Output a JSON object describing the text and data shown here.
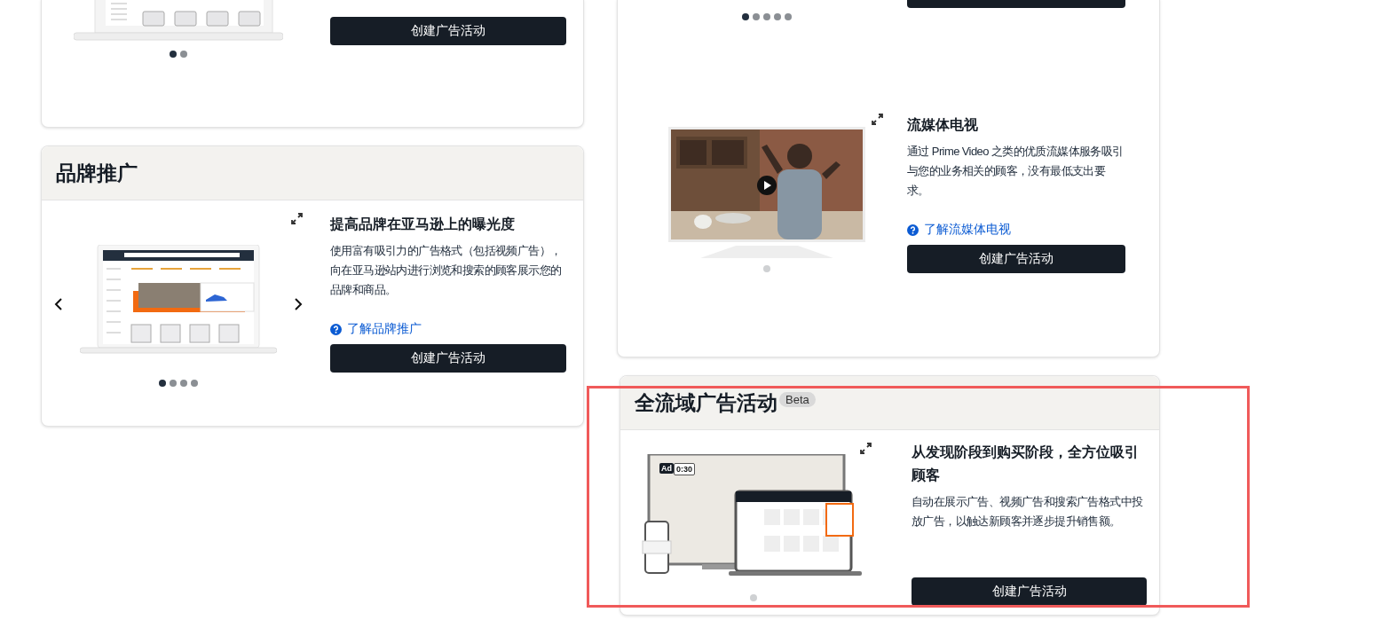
{
  "left_column": [
    {
      "kind": "cut",
      "sections": [
        {
          "kind": "laptop_cut",
          "button": "创建广告活动",
          "slides": [
            {
              "selected": true
            },
            {
              "selected": false
            }
          ]
        }
      ]
    },
    {
      "kind": "full",
      "title": "品牌推广",
      "sections": [
        {
          "kind": "laptop",
          "carousel": true,
          "heading": "提高品牌在亚马逊上的曝光度",
          "description": "使用富有吸引力的广告格式（包括视频广告），向在亚马逊站内进行浏览和搜索的顾客展示您的品牌和商品。",
          "link": "了解品牌推广",
          "button": "创建广告活动",
          "slides": [
            {
              "selected": true
            },
            {
              "selected": false
            },
            {
              "selected": false
            },
            {
              "selected": false
            }
          ]
        }
      ]
    }
  ],
  "right_column": [
    {
      "kind": "cut",
      "sections": [
        {
          "kind": "none",
          "slides": [
            {
              "selected": true
            },
            {
              "selected": false
            },
            {
              "selected": false
            },
            {
              "selected": false
            },
            {
              "selected": false
            }
          ]
        },
        {
          "kind": "tv",
          "heading": "流媒体电视",
          "description": "通过 Prime Video 之类的优质流媒体服务吸引与您的业务相关的顾客，没有最低支出要求。",
          "link": "了解流媒体电视",
          "button": "创建广告活动",
          "slides": [
            {
              "selected": false
            }
          ]
        }
      ]
    },
    {
      "kind": "full",
      "title": "全流域广告活动",
      "badge": "Beta",
      "highlighted": true,
      "sections": [
        {
          "kind": "devices",
          "ad_label": "Ad",
          "ad_time": "0:30",
          "heading": "从发现阶段到购买阶段，全方位吸引顾客",
          "description": "自动在展示广告、视频广告和搜索广告格式中投放广告，以触达新顾客并逐步提升销售额。",
          "button": "创建广告活动",
          "slides": [
            {
              "selected": false
            }
          ]
        }
      ]
    }
  ]
}
